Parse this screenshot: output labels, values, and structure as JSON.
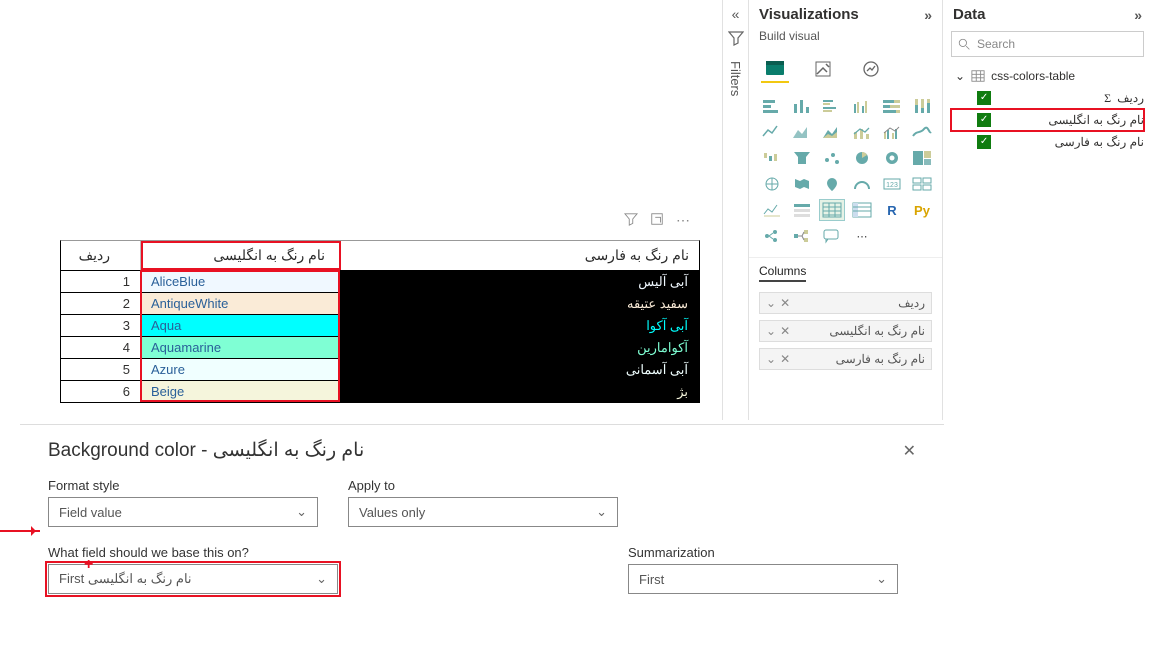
{
  "filters_label": "Filters",
  "viz": {
    "title": "Visualizations",
    "subtitle": "Build visual",
    "columns_tab": "Columns",
    "wells": [
      {
        "label": "ردیف"
      },
      {
        "label": "نام رنگ به انگلیسی"
      },
      {
        "label": "نام رنگ به فارسی"
      }
    ]
  },
  "data": {
    "title": "Data",
    "search_placeholder": "Search",
    "table_name": "css-colors-table",
    "fields": [
      {
        "label": "ردیف",
        "sigma": true,
        "selected": false
      },
      {
        "label": "نام رنگ به انگلیسی",
        "sigma": false,
        "selected": true
      },
      {
        "label": "نام رنگ به فارسی",
        "sigma": false,
        "selected": false
      }
    ]
  },
  "table": {
    "headers": {
      "row": "ردیف",
      "en": "نام رنگ به انگلیسی",
      "fa": "نام رنگ به فارسی"
    },
    "rows": [
      {
        "n": "1",
        "en": "AliceBlue",
        "fa": "آبی آلیس",
        "bg": "#F0F8FF",
        "facolor": "#f0f8ff"
      },
      {
        "n": "2",
        "en": "AntiqueWhite",
        "fa": "سفید عتیقه",
        "bg": "#FAEBD7",
        "facolor": "#faebd7"
      },
      {
        "n": "3",
        "en": "Aqua",
        "fa": "آبی آکوا",
        "bg": "#00FFFF",
        "facolor": "#00ffff"
      },
      {
        "n": "4",
        "en": "Aquamarine",
        "fa": "آکوامارین",
        "bg": "#7FFFD4",
        "facolor": "#7fffd4"
      },
      {
        "n": "5",
        "en": "Azure",
        "fa": "آبی آسمانی",
        "bg": "#F0FFFF",
        "facolor": "#f0ffff"
      },
      {
        "n": "6",
        "en": "Beige",
        "fa": "بژ",
        "bg": "#F5F5DC",
        "facolor": "#f5f5dc"
      }
    ]
  },
  "dialog": {
    "title": "Background color - نام رنگ به انگلیسی",
    "format_style_label": "Format style",
    "format_style_value": "Field value",
    "apply_to_label": "Apply to",
    "apply_to_value": "Values only",
    "base_field_label": "What field should we base this on?",
    "base_field_value": "First نام رنگ به انگلیسی",
    "summarization_label": "Summarization",
    "summarization_value": "First"
  }
}
